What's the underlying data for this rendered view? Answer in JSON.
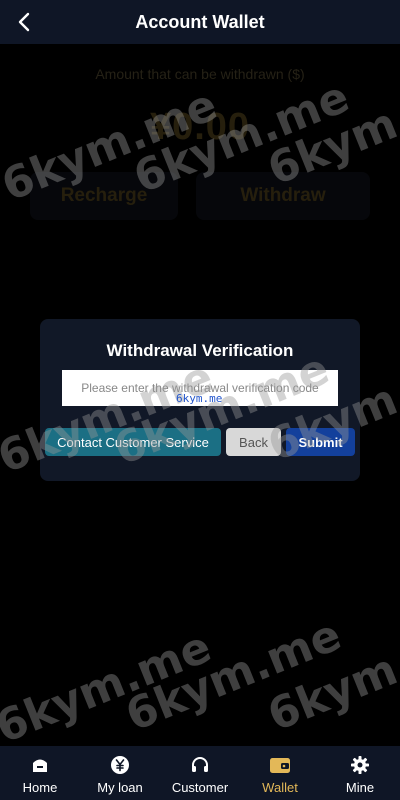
{
  "header": {
    "title": "Account Wallet"
  },
  "balance": {
    "label": "Amount that can be withdrawn ($)",
    "value": "¥0.00"
  },
  "actions": {
    "recharge_label": "Recharge",
    "withdraw_label": "Withdraw"
  },
  "modal": {
    "title": "Withdrawal Verification",
    "input_value": "",
    "input_placeholder": "Please enter the withdrawal verification code",
    "contact_label": "Contact Customer Service",
    "back_label": "Back",
    "submit_label": "Submit"
  },
  "tabbar": {
    "items": [
      {
        "label": "Home",
        "icon": "home-icon"
      },
      {
        "label": "My loan",
        "icon": "yen-coin-icon"
      },
      {
        "label": "Customer",
        "icon": "headset-icon"
      },
      {
        "label": "Wallet",
        "icon": "wallet-icon"
      },
      {
        "label": "Mine",
        "icon": "gear-icon"
      }
    ],
    "active_index": 3
  },
  "watermark": {
    "text": "6kym.me",
    "small_text": "6kym.me"
  },
  "colors": {
    "header_bg": "#0f1626",
    "modal_bg": "#111827",
    "contact_button": "#1b6f84",
    "submit_button": "#13409c",
    "back_button": "#d8d8d8",
    "active_tab": "#e3b858"
  }
}
